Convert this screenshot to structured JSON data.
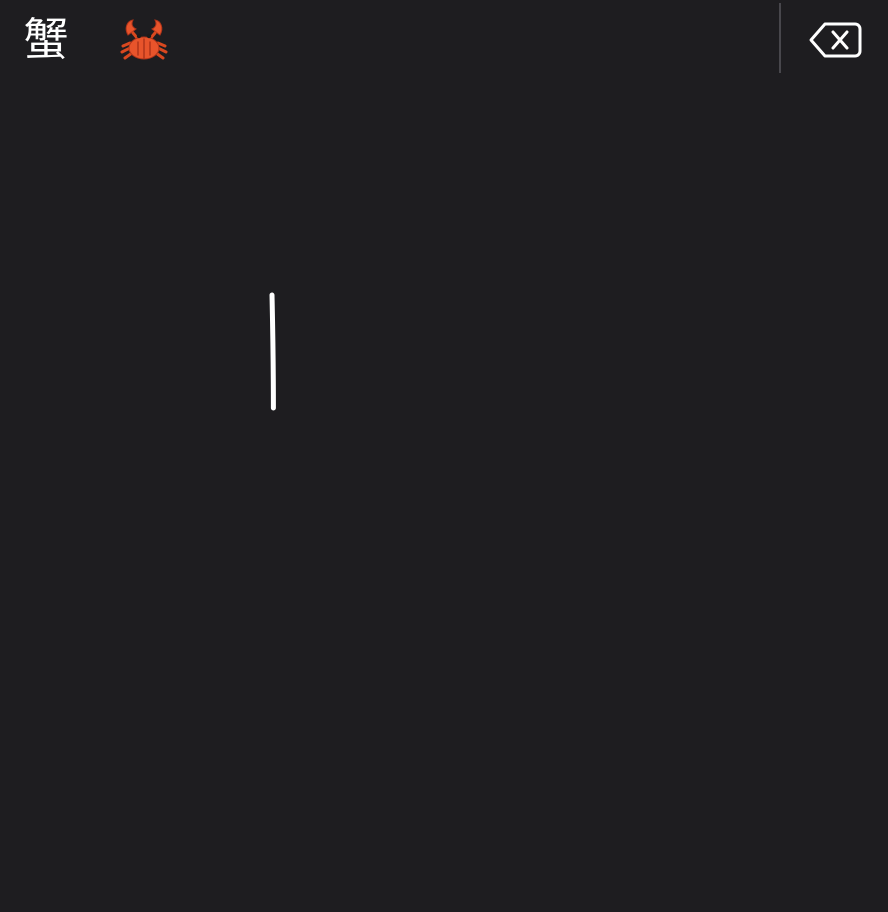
{
  "candidates": {
    "text_candidate": "蟹",
    "emoji_icon": "crab-emoji"
  },
  "toolbar": {
    "backspace_icon": "backspace-icon"
  },
  "colors": {
    "background": "#1e1d20",
    "text": "#ffffff",
    "divider": "#48474c",
    "stroke": "#ffffff",
    "crab_shell": "#e8542b",
    "crab_dark": "#b0341a"
  }
}
